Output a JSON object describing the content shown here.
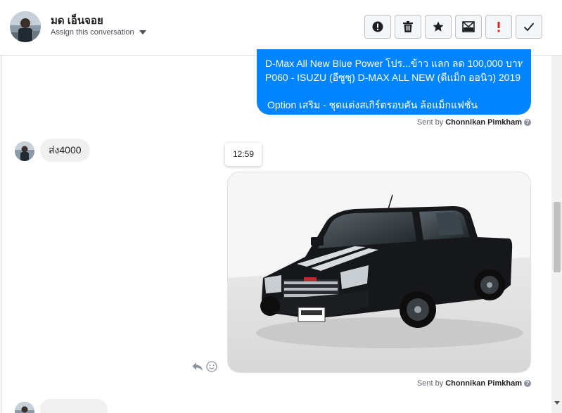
{
  "header": {
    "contact_name": "มด เอ็นจอย",
    "assign_label": "Assign this conversation",
    "toolbar_icons": [
      "spam-icon",
      "trash-icon",
      "star-icon",
      "mark-unread-icon",
      "important-icon",
      "check-icon"
    ]
  },
  "messages": {
    "outgoing": {
      "line1": "D-Max All New Blue Power โปร...ข้าว แลก ลด 100,000 บาท",
      "line2": "P060 - ISUZU (อีซูซุ) D-MAX ALL NEW (ดีแม็ก ออนิว) 2019",
      "line3": "Option เสริม - ชุดแต่งสเกิร์ตรอบคัน ล้อแม็กแฟชั่น",
      "sent_prefix": "Sent by",
      "sent_by": "Chonnikan Pimkham"
    },
    "incoming": {
      "text": "ส่ง4000"
    },
    "timestamp": "12:59",
    "image_sent_prefix": "Sent by",
    "image_sent_by": "Chonnikan Pimkham"
  },
  "colors": {
    "accent": "#0084ff",
    "incoming_bubble": "#f1f0f0",
    "important": "#e02020"
  }
}
